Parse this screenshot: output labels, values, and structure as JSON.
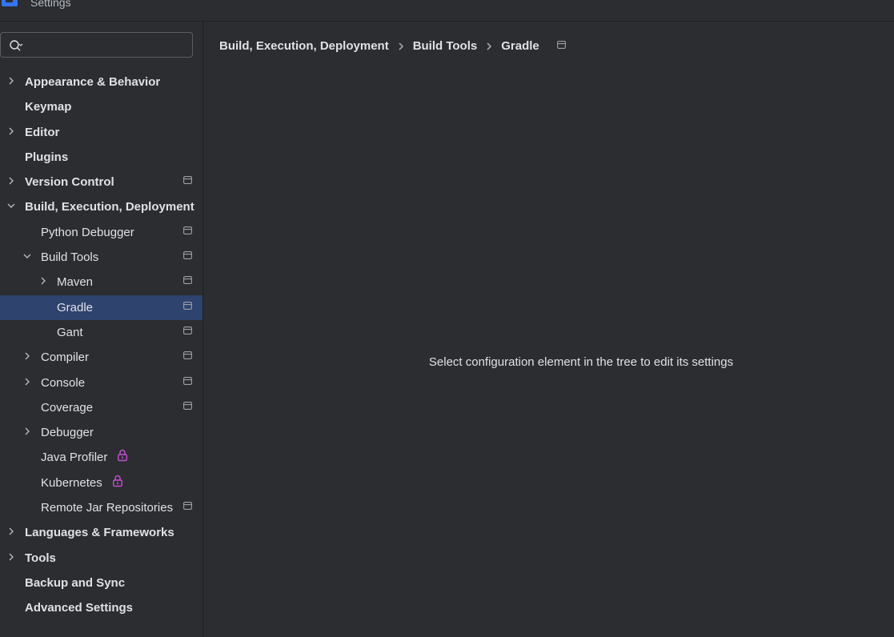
{
  "window": {
    "title": "Settings"
  },
  "search": {
    "value": "",
    "placeholder": ""
  },
  "tree": [
    {
      "label": "Appearance & Behavior",
      "level": 0,
      "expander": "collapsed",
      "bold": true,
      "badge": ""
    },
    {
      "label": "Keymap",
      "level": 0,
      "expander": "none",
      "bold": true,
      "badge": ""
    },
    {
      "label": "Editor",
      "level": 0,
      "expander": "collapsed",
      "bold": true,
      "badge": ""
    },
    {
      "label": "Plugins",
      "level": 0,
      "expander": "none",
      "bold": true,
      "badge": ""
    },
    {
      "label": "Version Control",
      "level": 0,
      "expander": "collapsed",
      "bold": true,
      "badge": "project"
    },
    {
      "label": "Build, Execution, Deployment",
      "level": 0,
      "expander": "expanded",
      "bold": true,
      "badge": ""
    },
    {
      "label": "Python Debugger",
      "level": 1,
      "expander": "none",
      "bold": false,
      "badge": "project"
    },
    {
      "label": "Build Tools",
      "level": 1,
      "expander": "expanded",
      "bold": false,
      "badge": "project"
    },
    {
      "label": "Maven",
      "level": 2,
      "expander": "collapsed",
      "bold": false,
      "badge": "project"
    },
    {
      "label": "Gradle",
      "level": 2,
      "expander": "none",
      "bold": false,
      "badge": "project",
      "selected": true
    },
    {
      "label": "Gant",
      "level": 2,
      "expander": "none",
      "bold": false,
      "badge": "project"
    },
    {
      "label": "Compiler",
      "level": 1,
      "expander": "collapsed",
      "bold": false,
      "badge": "project"
    },
    {
      "label": "Console",
      "level": 1,
      "expander": "collapsed",
      "bold": false,
      "badge": "project"
    },
    {
      "label": "Coverage",
      "level": 1,
      "expander": "none",
      "bold": false,
      "badge": "project"
    },
    {
      "label": "Debugger",
      "level": 1,
      "expander": "collapsed",
      "bold": false,
      "badge": ""
    },
    {
      "label": "Java Profiler",
      "level": 1,
      "expander": "none",
      "bold": false,
      "badge": "lock"
    },
    {
      "label": "Kubernetes",
      "level": 1,
      "expander": "none",
      "bold": false,
      "badge": "lock"
    },
    {
      "label": "Remote Jar Repositories",
      "level": 1,
      "expander": "none",
      "bold": false,
      "badge": "project"
    },
    {
      "label": "Languages & Frameworks",
      "level": 0,
      "expander": "collapsed",
      "bold": true,
      "badge": ""
    },
    {
      "label": "Tools",
      "level": 0,
      "expander": "collapsed",
      "bold": true,
      "badge": ""
    },
    {
      "label": "Backup and Sync",
      "level": 0,
      "expander": "none",
      "bold": true,
      "badge": ""
    },
    {
      "label": "Advanced Settings",
      "level": 0,
      "expander": "none",
      "bold": true,
      "badge": ""
    }
  ],
  "breadcrumb": [
    {
      "label": "Build, Execution, Deployment"
    },
    {
      "label": "Build Tools"
    },
    {
      "label": "Gradle"
    }
  ],
  "main": {
    "empty_message": "Select configuration element in the tree to edit its settings"
  },
  "colors": {
    "background": "#2b2d30",
    "selection": "#2e436e",
    "text": "#dfe1e5",
    "icon_gray": "#9da0a8",
    "lock": "#c94fd6",
    "accent": "#3574f0"
  },
  "icons": {
    "search": "search-icon",
    "expand": "chevron-right-icon",
    "collapse": "chevron-down-icon",
    "project": "project-level-icon",
    "lock": "lock-icon"
  }
}
